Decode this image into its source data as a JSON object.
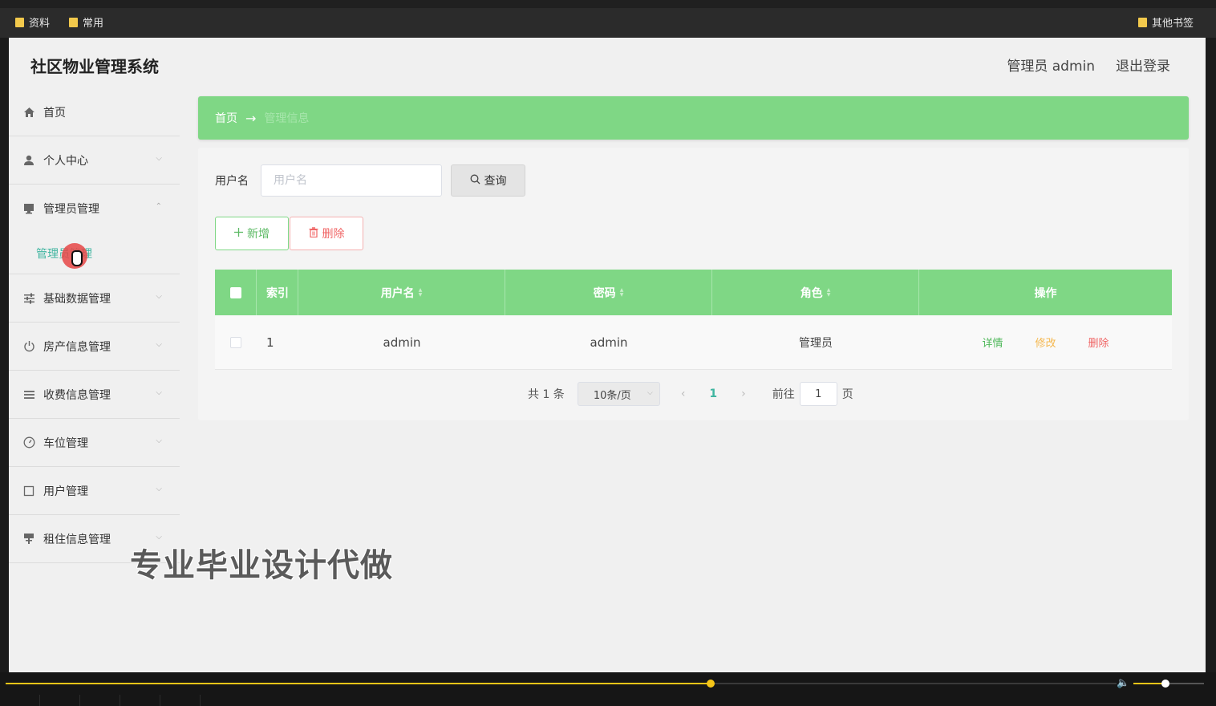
{
  "browser": {
    "bookmarks": [
      {
        "label": "资料"
      },
      {
        "label": "常用"
      }
    ],
    "other_bookmarks": "其他书签"
  },
  "header": {
    "title": "社区物业管理系统",
    "user": "管理员 admin",
    "logout": "退出登录"
  },
  "sidebar": {
    "items": [
      {
        "label": "首页",
        "icon": "home-icon"
      },
      {
        "label": "个人中心",
        "icon": "user-icon"
      },
      {
        "label": "管理员管理",
        "icon": "monitor-icon",
        "expanded": true,
        "sub": "管理员管理"
      },
      {
        "label": "基础数据管理",
        "icon": "sliders-icon"
      },
      {
        "label": "房产信息管理",
        "icon": "power-icon"
      },
      {
        "label": "收费信息管理",
        "icon": "list-icon"
      },
      {
        "label": "车位管理",
        "icon": "gauge-icon"
      },
      {
        "label": "用户管理",
        "icon": "square-icon"
      },
      {
        "label": "租住信息管理",
        "icon": "signpost-icon"
      }
    ]
  },
  "breadcrumb": {
    "home": "首页",
    "arrow": "→",
    "current": "管理信息"
  },
  "search": {
    "label": "用户名",
    "placeholder": "用户名",
    "button": "查询"
  },
  "actions": {
    "add": "新增",
    "delete": "删除"
  },
  "table": {
    "columns": [
      "索引",
      "用户名",
      "密码",
      "角色",
      "操作"
    ],
    "rows": [
      {
        "index": "1",
        "username": "admin",
        "password": "admin",
        "role": "管理员"
      }
    ],
    "row_actions": {
      "detail": "详情",
      "edit": "修改",
      "delete": "删除"
    }
  },
  "pagination": {
    "total": "共 1 条",
    "page_size": "10条/页",
    "current_page": "1",
    "goto_label": "前往",
    "goto_value": "1",
    "page_suffix": "页"
  },
  "watermark": "专业毕业设计代做",
  "player": {
    "progress": 0.635,
    "volume": 0.45,
    "accent_color": "#f5c518"
  },
  "colors": {
    "primary_green": "#7fd785",
    "link_teal": "#3fb5a0",
    "danger": "#f06565",
    "warning": "#f5b74d"
  }
}
